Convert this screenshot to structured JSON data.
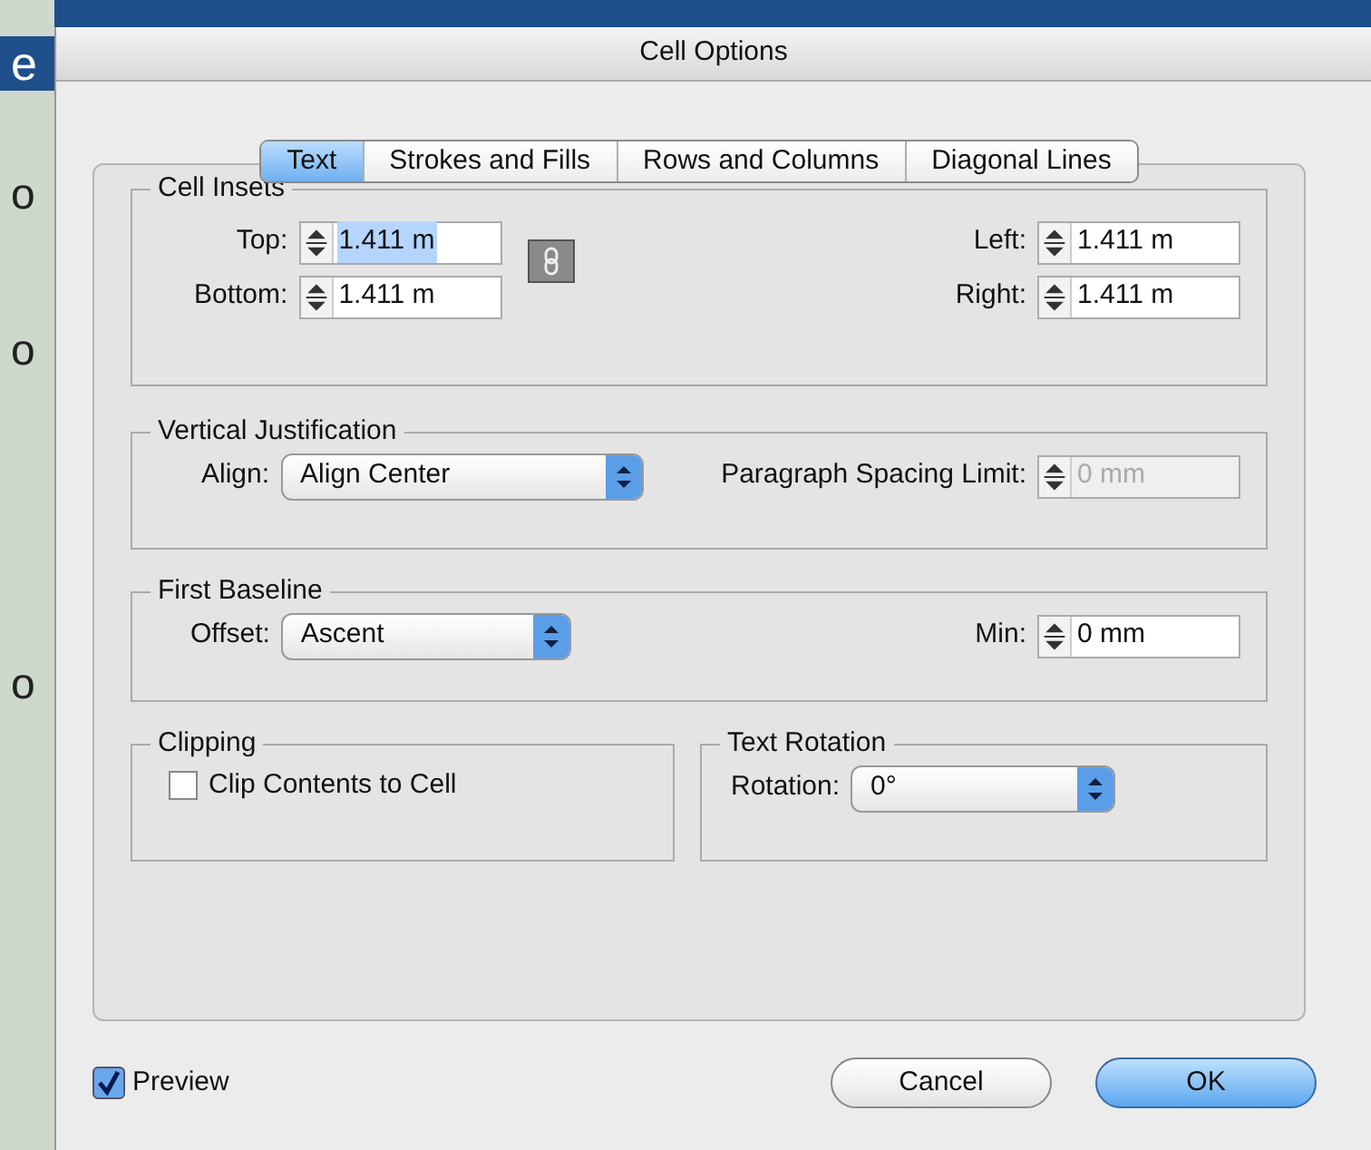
{
  "background": {
    "fragments": [
      "e",
      "o",
      "o",
      "o"
    ]
  },
  "window": {
    "title": "Cell Options"
  },
  "tabs": [
    {
      "label": "Text",
      "selected": true
    },
    {
      "label": "Strokes and Fills",
      "selected": false
    },
    {
      "label": "Rows and Columns",
      "selected": false
    },
    {
      "label": "Diagonal Lines",
      "selected": false
    }
  ],
  "cell_insets": {
    "title": "Cell Insets",
    "left_fields": [
      {
        "label": "Top:",
        "value": "1.411 m",
        "selected": true
      },
      {
        "label": "Bottom:",
        "value": "1.411 m",
        "selected": false
      }
    ],
    "right_fields": [
      {
        "label": "Left:",
        "value": "1.411 m",
        "selected": false
      },
      {
        "label": "Right:",
        "value": "1.411 m",
        "selected": false
      }
    ]
  },
  "vertical_justification": {
    "title": "Vertical Justification",
    "align": {
      "label": "Align:",
      "value": "Align Center"
    },
    "paragraph_spacing_limit": {
      "label": "Paragraph Spacing Limit:",
      "value": "0 mm",
      "disabled": true
    }
  },
  "first_baseline": {
    "title": "First Baseline",
    "offset": {
      "label": "Offset:",
      "value": "Ascent"
    },
    "min": {
      "label": "Min:",
      "value": "0 mm",
      "disabled": false
    }
  },
  "clipping": {
    "title": "Clipping",
    "checkbox": {
      "label": "Clip Contents to Cell",
      "checked": false
    }
  },
  "text_rotation": {
    "title": "Text Rotation",
    "rotation": {
      "label": "Rotation:",
      "value": "0°"
    }
  },
  "preview": {
    "label": "Preview",
    "checked": true
  },
  "buttons": [
    {
      "label": "Cancel",
      "default": false
    },
    {
      "label": "OK",
      "default": true
    }
  ]
}
